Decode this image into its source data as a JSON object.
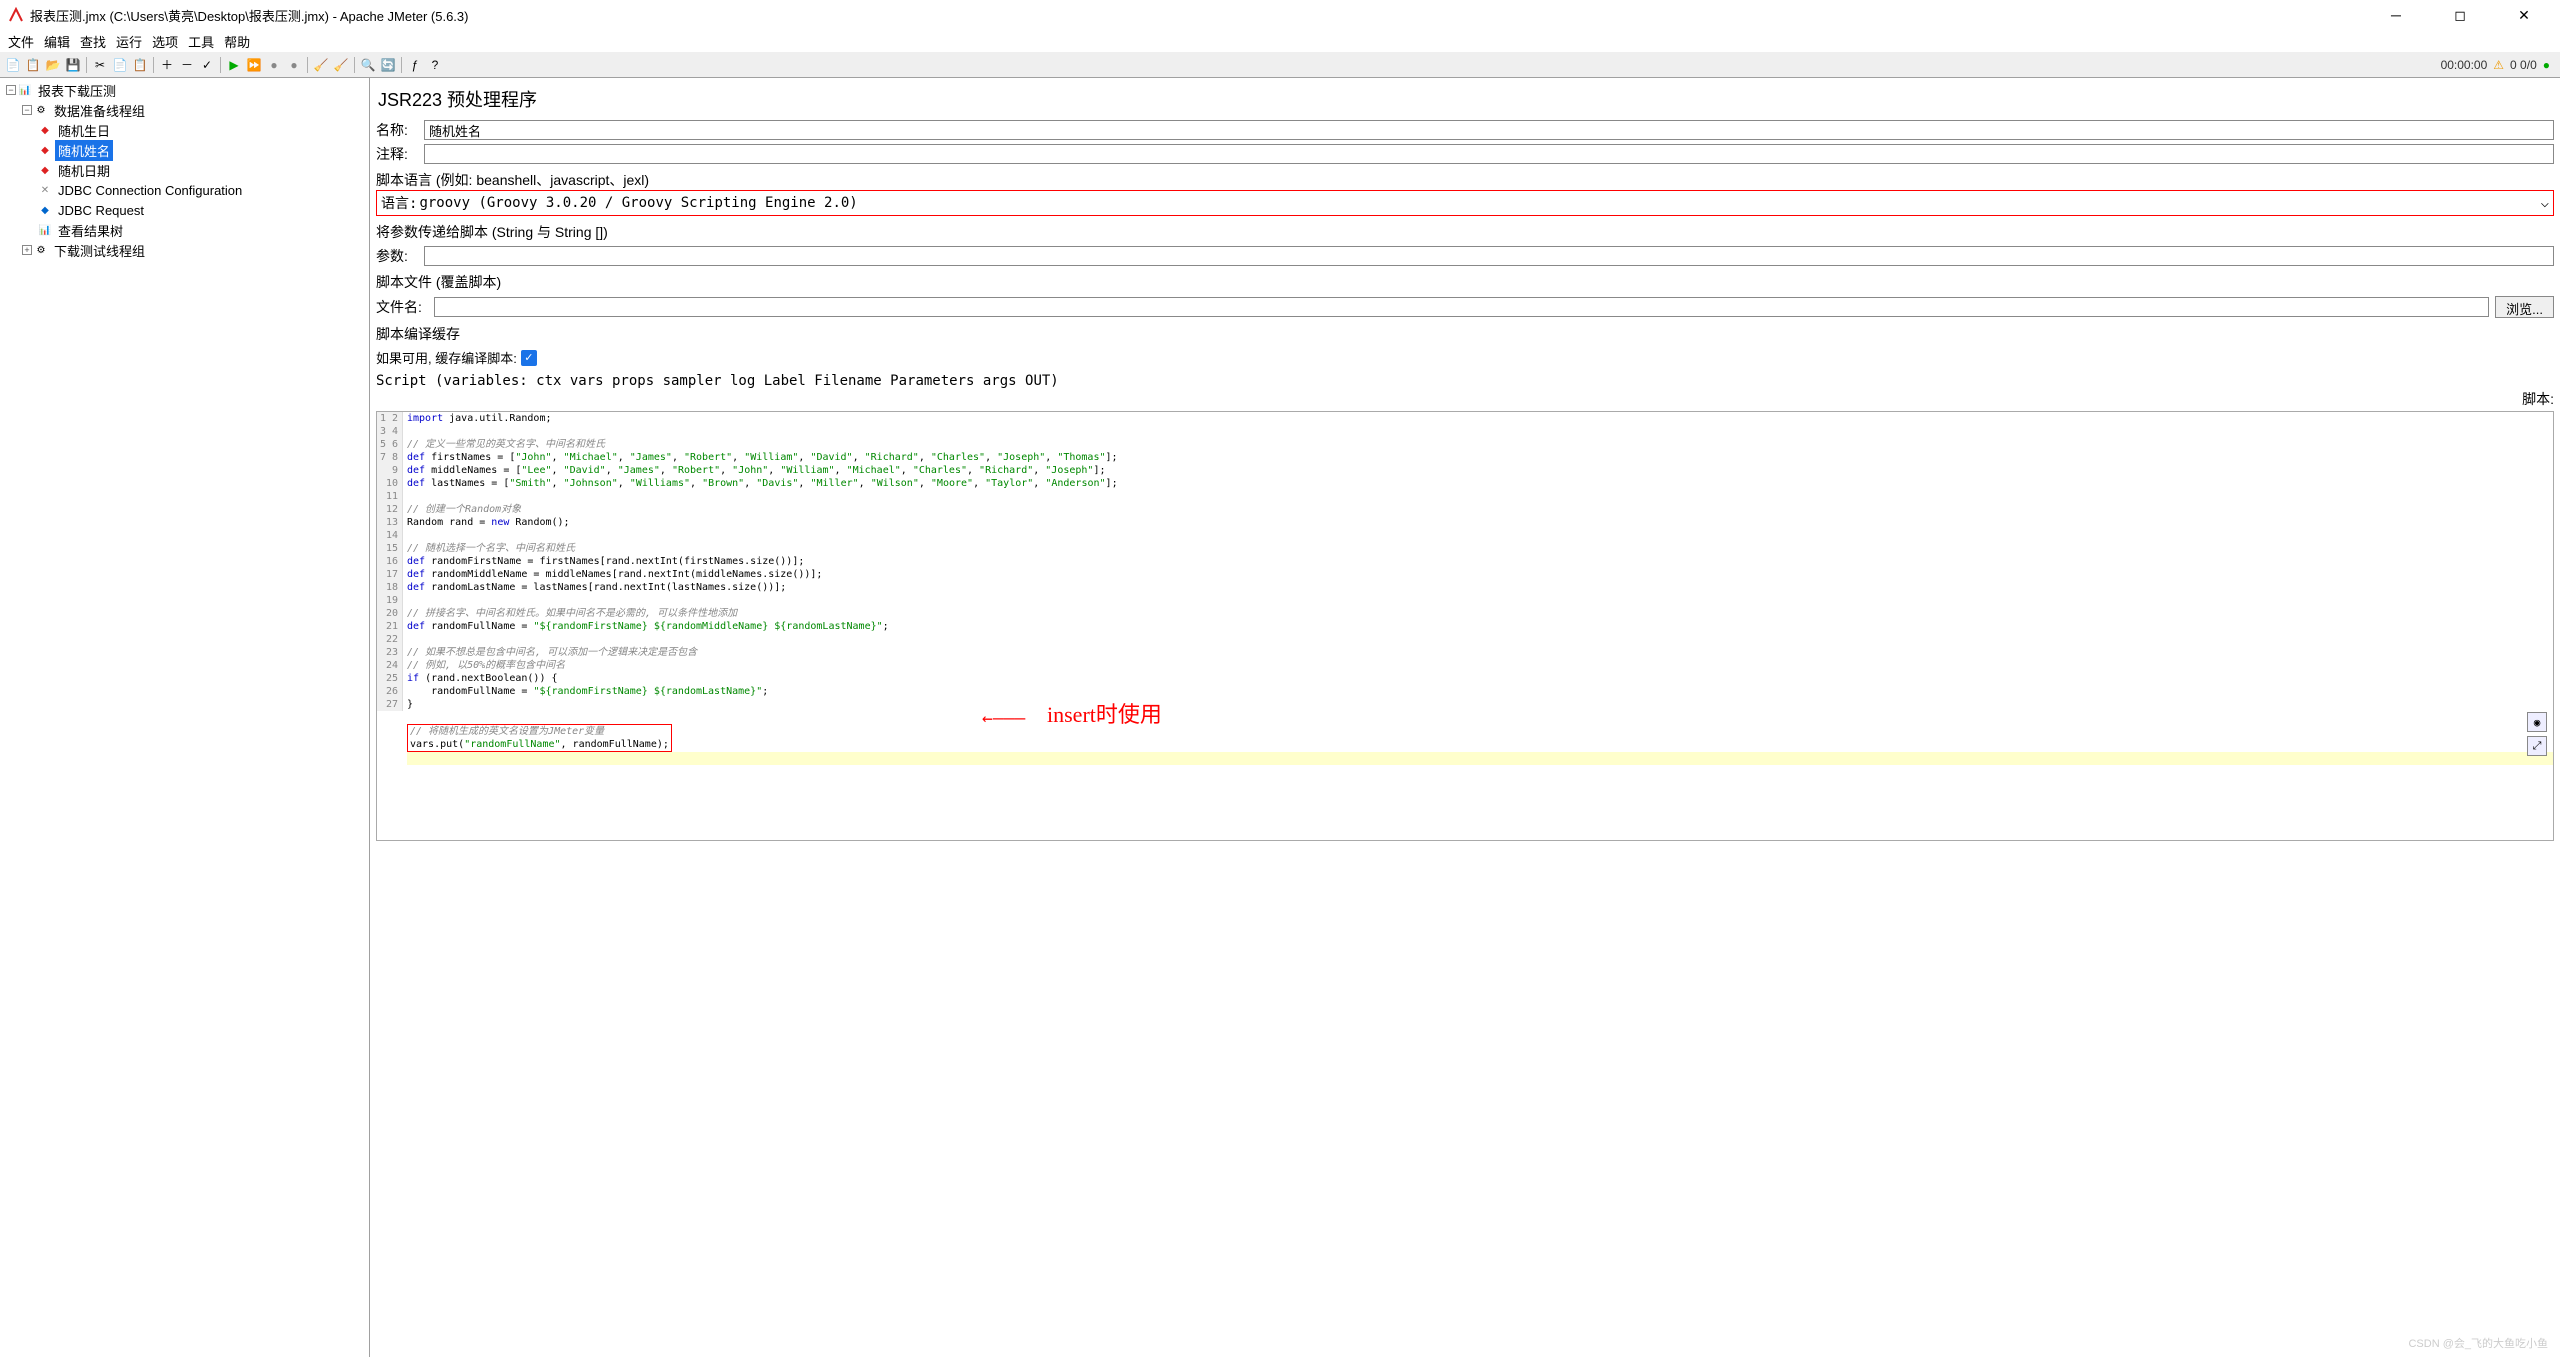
{
  "window": {
    "title": "报表压测.jmx (C:\\Users\\黄亮\\Desktop\\报表压测.jmx) - Apache JMeter (5.6.3)"
  },
  "menu": [
    "文件",
    "编辑",
    "查找",
    "运行",
    "选项",
    "工具",
    "帮助"
  ],
  "status": {
    "time": "00:00:00",
    "counts": "0 0/0"
  },
  "tree": {
    "root": "报表下载压测",
    "group1": "数据准备线程组",
    "items": [
      "随机生日",
      "随机姓名",
      "随机日期",
      "JDBC Connection Configuration",
      "JDBC Request",
      "查看结果树"
    ],
    "group2": "下载测试线程组"
  },
  "panel": {
    "title": "JSR223 预处理程序",
    "nameLabel": "名称:",
    "nameValue": "随机姓名",
    "commentLabel": "注释:",
    "scriptLangHeader": "脚本语言 (例如: beanshell、javascript、jexl)",
    "langLabel": "语言:",
    "langValue": "groovy     (Groovy 3.0.20 / Groovy Scripting Engine 2.0)",
    "argsHeader": "将参数传递给脚本 (String 与 String [])",
    "paramsLabel": "参数:",
    "fileHeader": "脚本文件 (覆盖脚本)",
    "fileLabel": "文件名:",
    "browseBtn": "浏览...",
    "cacheHeader": "脚本编译缓存",
    "cacheLabel": "如果可用, 缓存编译脚本:",
    "scriptVarHeader": "Script (variables: ctx vars props sampler log Label Filename Parameters args OUT)",
    "scriptLabel": "脚本:"
  },
  "annotation": "insert时使用",
  "watermark": "CSDN @会_飞的大鱼吃小鱼",
  "code": {
    "lines": 27
  }
}
